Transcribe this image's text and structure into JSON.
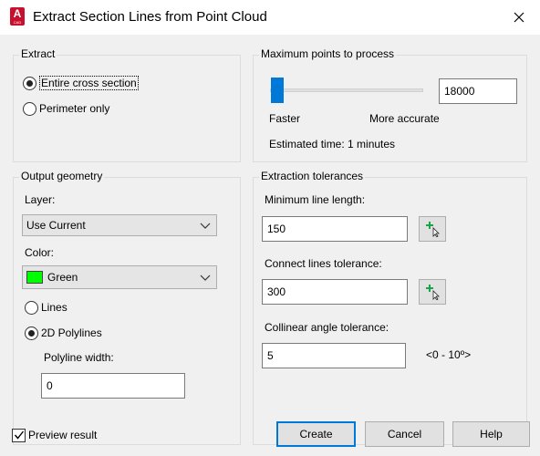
{
  "window": {
    "title": "Extract Section Lines from Point Cloud",
    "icon_letter": "A",
    "icon_sub": "CAD"
  },
  "extract": {
    "label": "Extract",
    "options": [
      {
        "label": "Entire cross section",
        "checked": true
      },
      {
        "label": "Perimeter only",
        "checked": false
      }
    ]
  },
  "max_points": {
    "label": "Maximum points to process",
    "value": "18000",
    "slider_level_percent": 5,
    "min_label": "Faster",
    "max_label": "More accurate",
    "estimate": "Estimated time: 1 minutes"
  },
  "output_geometry": {
    "label": "Output geometry",
    "layer_label": "Layer:",
    "layer_value": "Use Current",
    "color_label": "Color:",
    "color_value": "Green",
    "color_hex": "#00ff00",
    "geometry_options": [
      {
        "label": "Lines",
        "checked": false
      },
      {
        "label": "2D Polylines",
        "checked": true
      }
    ],
    "polyline_width_label": "Polyline width:",
    "polyline_width_value": "0"
  },
  "tolerances": {
    "label": "Extraction tolerances",
    "min_line_label": "Minimum line length:",
    "min_line_value": "150",
    "connect_label": "Connect lines tolerance:",
    "connect_value": "300",
    "collinear_label": "Collinear angle tolerance:",
    "collinear_value": "5",
    "collinear_range": "<0 - 10º>"
  },
  "footer": {
    "preview_label": "Preview result",
    "preview_checked": true,
    "create_label": "Create",
    "cancel_label": "Cancel",
    "help_label": "Help"
  },
  "colors": {
    "accent": "#0078d7",
    "app_icon": "#c8102e",
    "pick_plus": "#1aa34a"
  }
}
